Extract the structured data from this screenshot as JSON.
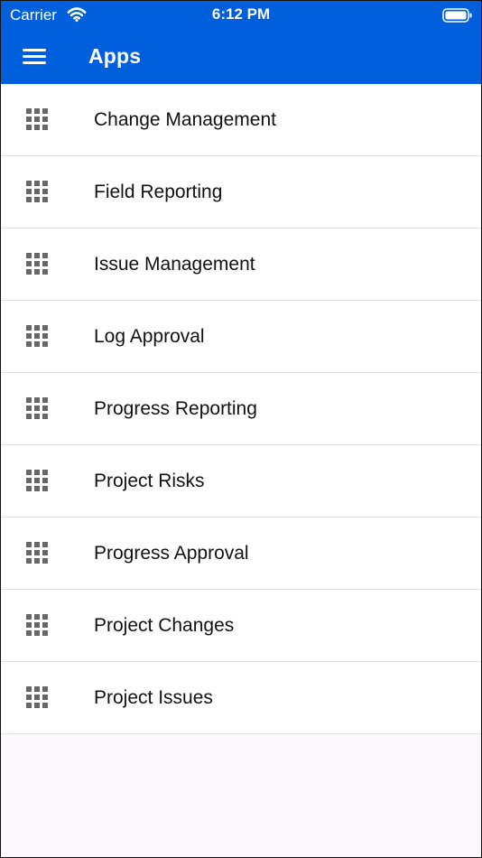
{
  "status_bar": {
    "carrier": "Carrier",
    "time": "6:12 PM",
    "icons": [
      "wifi-icon",
      "battery-icon"
    ]
  },
  "header": {
    "menu_icon": "hamburger-menu-icon",
    "title": "Apps"
  },
  "apps": {
    "icon": "grid-icon",
    "items": [
      {
        "label": "Change Management"
      },
      {
        "label": "Field Reporting"
      },
      {
        "label": "Issue Management"
      },
      {
        "label": "Log Approval"
      },
      {
        "label": "Progress Reporting"
      },
      {
        "label": "Project Risks"
      },
      {
        "label": "Progress Approval"
      },
      {
        "label": "Project Changes"
      },
      {
        "label": "Project Issues"
      }
    ]
  },
  "colors": {
    "header_bg": "#005fdc",
    "icon": "#666666",
    "text": "#111111",
    "divider": "#e2e2e2",
    "empty_bg": "#fdf8fb"
  }
}
